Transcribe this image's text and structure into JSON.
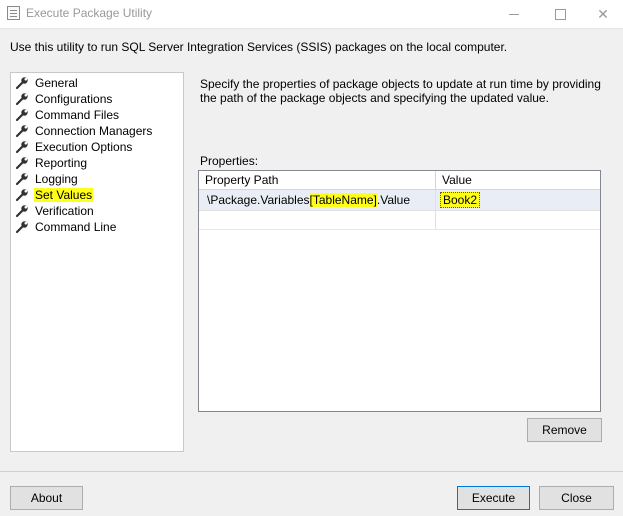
{
  "window": {
    "title": "Execute Package Utility",
    "close_glyph": "✕"
  },
  "description": "Use this utility to run SQL Server Integration Services (SSIS) packages on the local computer.",
  "nav": {
    "items": [
      {
        "label": "General"
      },
      {
        "label": "Configurations"
      },
      {
        "label": "Command Files"
      },
      {
        "label": "Connection Managers"
      },
      {
        "label": "Execution Options"
      },
      {
        "label": "Reporting"
      },
      {
        "label": "Logging"
      },
      {
        "label": "Set Values",
        "selected": true
      },
      {
        "label": "Verification"
      },
      {
        "label": "Command Line"
      }
    ]
  },
  "set_values": {
    "description": "Specify the properties of package objects to update at run time by providing the path of the package objects and specifying the updated value.",
    "properties_label": "Properties:",
    "columns": [
      "Property Path",
      "Value"
    ],
    "rows": [
      {
        "path_prefix": "\\Package.Variables",
        "path_highlight": "[TableName]",
        "path_suffix": ".Value",
        "value": "Book2"
      }
    ],
    "remove_label": "Remove"
  },
  "footer": {
    "about_label": "About",
    "execute_label": "Execute",
    "close_label": "Close"
  },
  "colors": {
    "highlight": "#ffff1a",
    "selected_row": "#e9eef6",
    "default_button_border": "#0078d7"
  }
}
